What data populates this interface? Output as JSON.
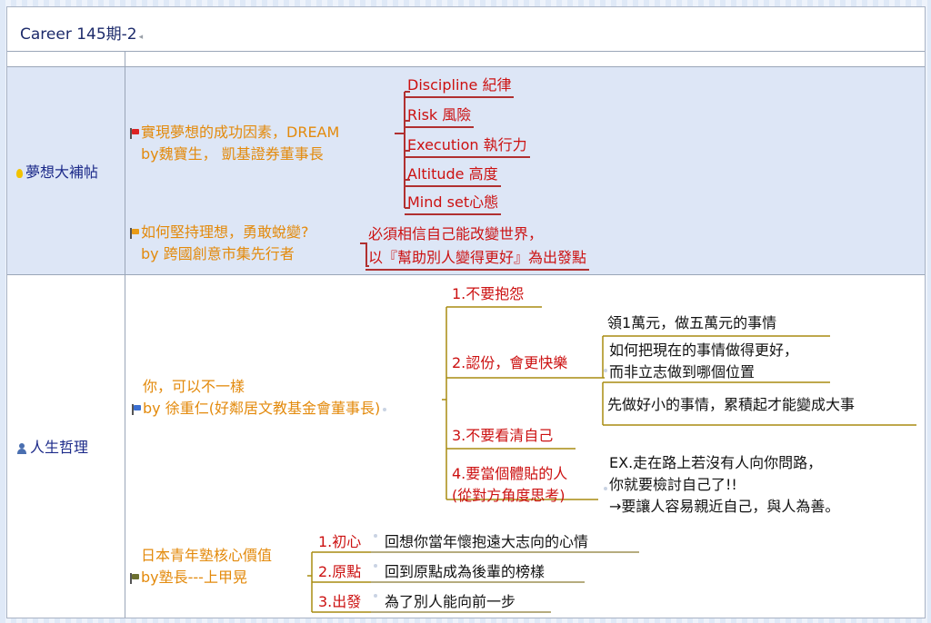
{
  "title": "Career 145期-2",
  "sections": [
    {
      "category": "夢想大補帖",
      "topics": [
        {
          "lines": [
            "實現夢想的成功因素，DREAM",
            "by魏寶生， 凱基證券董事長"
          ],
          "children": [
            "Discipline 紀律",
            "Risk 風險",
            "Execution 執行力",
            "Altitude 高度",
            "Mind set心態"
          ]
        },
        {
          "lines": [
            "如何堅持理想，勇敢蛻變?",
            "by 跨國創意市集先行者"
          ],
          "children": [
            "必須相信自己能改變世界，",
            "以『幫助別人變得更好』為出發點"
          ]
        }
      ]
    },
    {
      "category": "人生哲理",
      "topics": [
        {
          "lines": [
            "你，可以不一樣",
            "by 徐重仁(好鄰居文教基金會董事長)"
          ],
          "children": [
            {
              "label": "1.不要抱怨"
            },
            {
              "label": "2.認份，會更快樂",
              "notes": [
                "領1萬元，做五萬元的事情",
                "如何把現在的事情做得更好，",
                "而非立志做到哪個位置",
                "先做好小的事情，累積起才能變成大事"
              ]
            },
            {
              "label": "3.不要看清自己"
            },
            {
              "label_lines": [
                "4.要當個體貼的人",
                "(從對方角度思考)"
              ],
              "notes": [
                "EX.走在路上若沒有人向你問路，",
                "你就要檢討自己了!!",
                "→要讓人容易親近自己，與人為善。"
              ]
            }
          ]
        },
        {
          "lines": [
            "日本青年塾核心價值",
            "by塾長---上甲晃"
          ],
          "children": [
            {
              "label": "1.初心",
              "note": "回想你當年懷抱遠大志向的心情"
            },
            {
              "label": "2.原點",
              "note": "回到原點成為後輩的榜樣"
            },
            {
              "label": "3.出發",
              "note": "為了別人能向前一步"
            }
          ]
        }
      ]
    }
  ]
}
